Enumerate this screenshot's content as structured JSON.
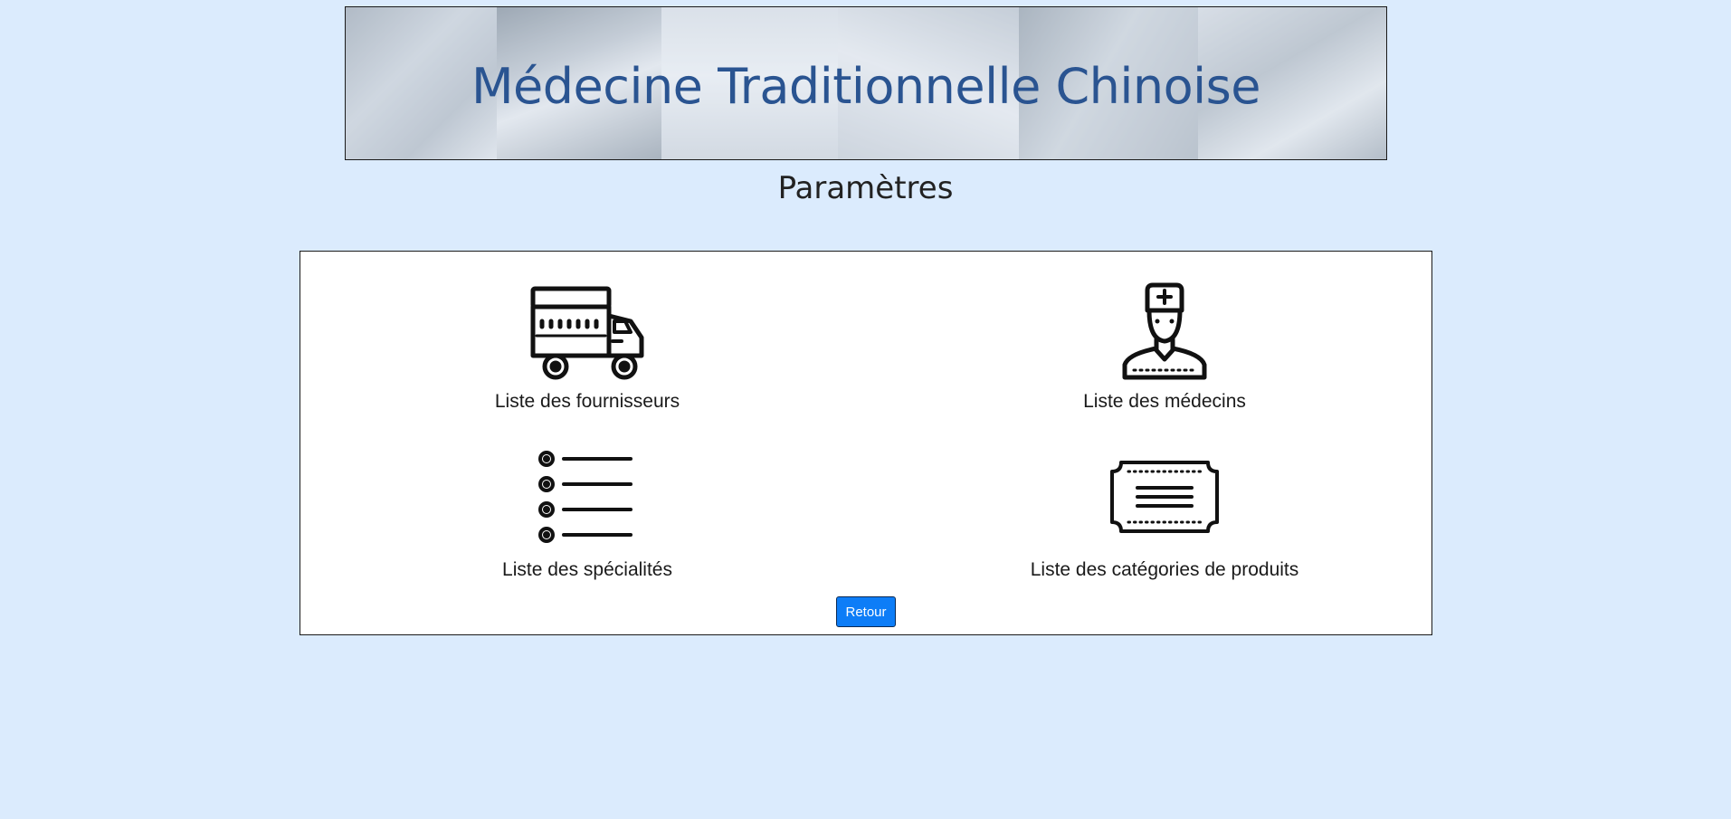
{
  "header": {
    "banner_title": "Médecine Traditionnelle Chinoise"
  },
  "page": {
    "title": "Paramètres"
  },
  "tiles": [
    {
      "label": "Liste des fournisseurs",
      "icon": "truck-icon"
    },
    {
      "label": "Liste des médecins",
      "icon": "doctor-icon"
    },
    {
      "label": "Liste des spécialités",
      "icon": "list-icon"
    },
    {
      "label": "Liste des catégories de produits",
      "icon": "ticket-icon"
    }
  ],
  "actions": {
    "back_label": "Retour"
  },
  "colors": {
    "background": "#dbebfd",
    "banner_title": "#2a5491",
    "button": "#0d7df7"
  }
}
